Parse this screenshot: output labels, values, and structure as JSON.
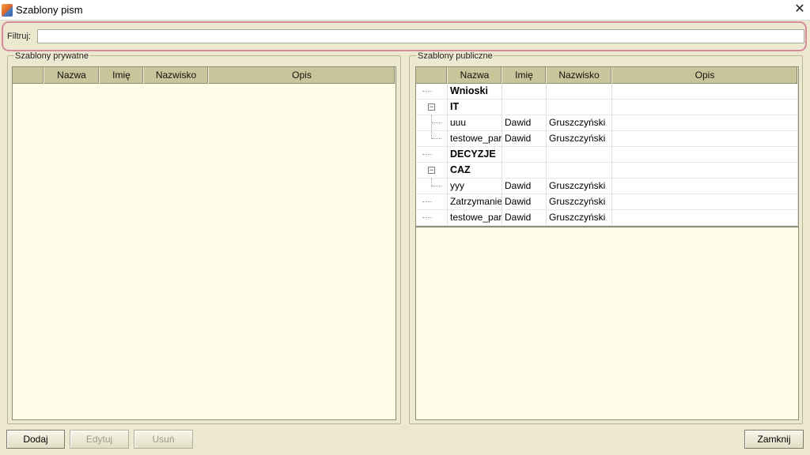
{
  "window": {
    "title": "Szablony pism",
    "close_symbol": "✕"
  },
  "filter": {
    "label": "Filtruj:",
    "value": ""
  },
  "private_templates": {
    "legend": "Szablony prywatne",
    "columns": [
      "",
      "Nazwa",
      "Imię",
      "Nazwisko",
      "Opis"
    ],
    "rows": []
  },
  "public_templates": {
    "legend": "Szablony publiczne",
    "columns": [
      "",
      "Nazwa",
      "Imię",
      "Nazwisko",
      "Opis"
    ],
    "rows": [
      {
        "name": "Wnioski",
        "first_name": "",
        "last_name": "",
        "description": "",
        "type": "group"
      },
      {
        "name": "IT",
        "first_name": "",
        "last_name": "",
        "description": "",
        "type": "expanded-group"
      },
      {
        "name": "uuu",
        "first_name": "Dawid",
        "last_name": "Gruszczyński",
        "description": "",
        "type": "child"
      },
      {
        "name": "testowe_para",
        "first_name": "Dawid",
        "last_name": "Gruszczyński",
        "description": "",
        "type": "child-last"
      },
      {
        "name": "DECYZJE",
        "first_name": "",
        "last_name": "",
        "description": "",
        "type": "group"
      },
      {
        "name": "CAZ",
        "first_name": "",
        "last_name": "",
        "description": "",
        "type": "expanded-group"
      },
      {
        "name": "yyy",
        "first_name": "Dawid",
        "last_name": "Gruszczyński",
        "description": "",
        "type": "child-last"
      },
      {
        "name": "Zatrzymanie",
        "first_name": "Dawid",
        "last_name": "Gruszczyński",
        "description": "",
        "type": "leaf"
      },
      {
        "name": "testowe_para",
        "first_name": "Dawid",
        "last_name": "Gruszczyński",
        "description": "",
        "type": "leaf"
      }
    ]
  },
  "buttons": {
    "add": "Dodaj",
    "edit": "Edytuj",
    "delete": "Usuń",
    "close": "Zamknij"
  },
  "icons": {
    "app": "app-logo-icon",
    "close": "close-icon",
    "expander": "collapse-minus-icon"
  }
}
